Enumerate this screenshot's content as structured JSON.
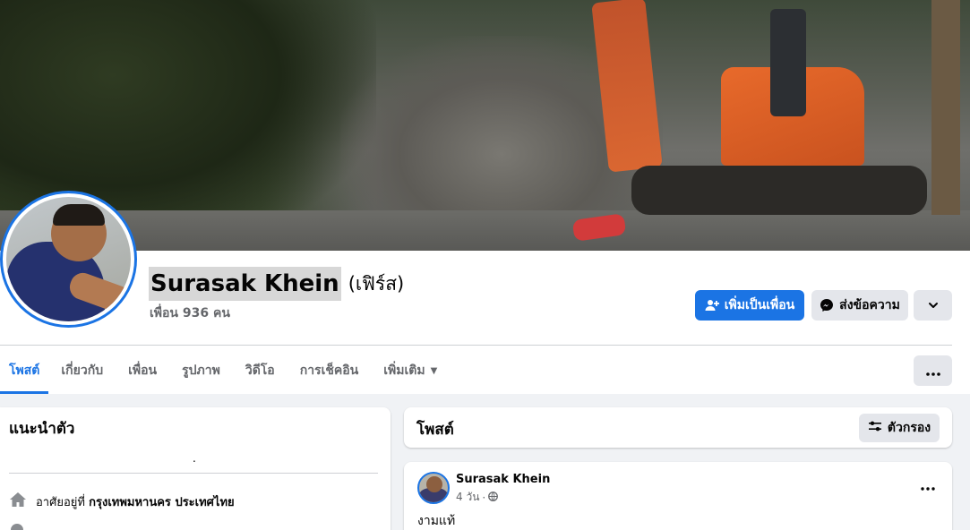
{
  "profile": {
    "name": "Surasak Khein",
    "alternate_name": "(เฟิร์ส)",
    "friends_count": "เพื่อน 936 คน"
  },
  "actions": {
    "add_friend_label": "เพิ่มเป็นเพื่อน",
    "message_label": "ส่งข้อความ"
  },
  "tabs": [
    {
      "label": "โพสต์",
      "active": true
    },
    {
      "label": "เกี่ยวกับ",
      "active": false
    },
    {
      "label": "เพื่อน",
      "active": false
    },
    {
      "label": "รูปภาพ",
      "active": false
    },
    {
      "label": "วิดีโอ",
      "active": false
    },
    {
      "label": "การเช็คอิน",
      "active": false
    },
    {
      "label": "เพิ่มเติม",
      "active": false
    }
  ],
  "intro": {
    "title": "แนะนำตัว",
    "dot": ".",
    "location_prefix": "อาศัยอยู่ที่",
    "location": "กรุงเทพมหานคร ประเทศไทย"
  },
  "posts_section": {
    "title": "โพสต์",
    "filter_label": "ตัวกรอง"
  },
  "post": {
    "author": "Surasak Khein",
    "time": "4 วัน",
    "separator": "·",
    "text": "งามแท้"
  },
  "colors": {
    "accent": "#1b74e4",
    "secondary_button": "#e4e6eb",
    "background": "#f0f2f5"
  },
  "icons": {
    "add_friend": "person-plus-icon",
    "message": "messenger-icon",
    "chevron": "chevron-down-icon",
    "more": "more-horizontal-icon",
    "filter": "sliders-icon",
    "home": "home-icon",
    "globe": "globe-icon"
  }
}
